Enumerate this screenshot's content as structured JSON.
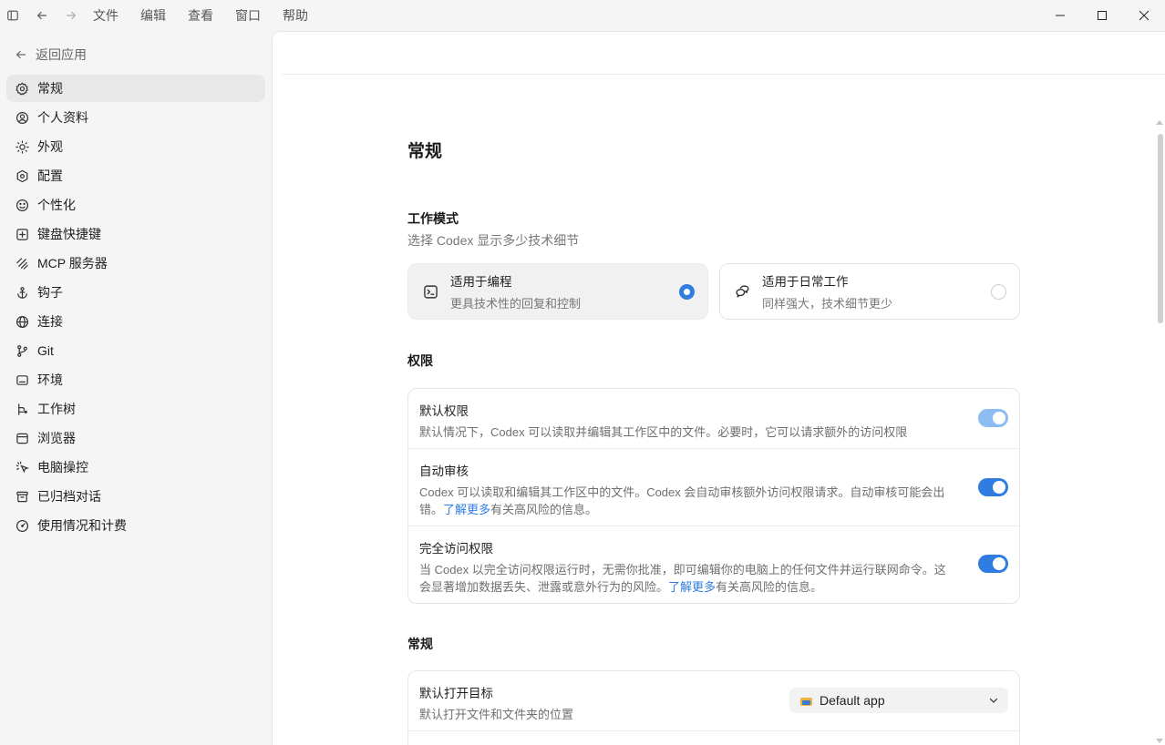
{
  "menu": {
    "file": "文件",
    "edit": "编辑",
    "view": "查看",
    "window": "窗口",
    "help": "帮助"
  },
  "sidebar": {
    "back_label": "返回应用",
    "items": [
      {
        "label": "常规",
        "icon": "gear-icon",
        "active": true
      },
      {
        "label": "个人资料",
        "icon": "user-circle-icon"
      },
      {
        "label": "外观",
        "icon": "sun-icon"
      },
      {
        "label": "配置",
        "icon": "config-icon"
      },
      {
        "label": "个性化",
        "icon": "personalize-icon"
      },
      {
        "label": "键盘快捷键",
        "icon": "keyboard-icon"
      },
      {
        "label": "MCP 服务器",
        "icon": "mcp-icon"
      },
      {
        "label": "钩子",
        "icon": "anchor-icon"
      },
      {
        "label": "连接",
        "icon": "globe-icon"
      },
      {
        "label": "Git",
        "icon": "git-branch-icon"
      },
      {
        "label": "环境",
        "icon": "environment-icon"
      },
      {
        "label": "工作树",
        "icon": "worktree-icon"
      },
      {
        "label": "浏览器",
        "icon": "browser-icon"
      },
      {
        "label": "电脑操控",
        "icon": "computer-control-icon"
      },
      {
        "label": "已归档对话",
        "icon": "archive-icon"
      },
      {
        "label": "使用情况和计费",
        "icon": "gauge-icon"
      }
    ]
  },
  "main": {
    "page_title": "常规",
    "work_mode": {
      "title": "工作模式",
      "subtitle": "选择 Codex 显示多少技术细节",
      "options": [
        {
          "title": "适用于编程",
          "subtitle": "更具技术性的回复和控制",
          "selected": true
        },
        {
          "title": "适用于日常工作",
          "subtitle": "同样强大，技术细节更少",
          "selected": false
        }
      ]
    },
    "permissions": {
      "title": "权限",
      "rows": [
        {
          "title": "默认权限",
          "desc": "默认情况下，Codex 可以读取并编辑其工作区中的文件。必要时，它可以请求额外的访问权限",
          "enabled": true,
          "disabled_look": true
        },
        {
          "title": "自动审核",
          "desc_before": "Codex 可以读取和编辑其工作区中的文件。Codex 会自动审核额外访问权限请求。自动审核可能会出错。",
          "link": "了解更多",
          "desc_after": "有关高风险的信息。",
          "enabled": true
        },
        {
          "title": "完全访问权限",
          "desc_before": "当 Codex 以完全访问权限运行时，无需你批准，即可编辑你的电脑上的任何文件并运行联网命令。这会显著增加数据丢失、泄露或意外行为的风险。",
          "link": "了解更多",
          "desc_after": "有关高风险的信息。",
          "enabled": true
        }
      ]
    },
    "general": {
      "title": "常规",
      "rows": [
        {
          "title": "默认打开目标",
          "desc": "默认打开文件和文件夹的位置",
          "select_value": "Default app"
        }
      ]
    }
  },
  "colors": {
    "accent": "#2f7de1",
    "sidebar_bg": "#f5f5f5",
    "active_item_bg": "#e8e8e8"
  }
}
